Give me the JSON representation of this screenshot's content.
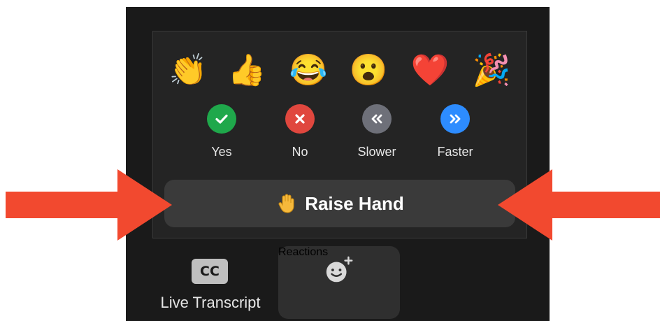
{
  "reactions": {
    "emojis": [
      {
        "name": "clapping-hands",
        "glyph": "👏"
      },
      {
        "name": "thumbs-up",
        "glyph": "👍"
      },
      {
        "name": "tears-of-joy",
        "glyph": "😂"
      },
      {
        "name": "open-mouth",
        "glyph": "😮"
      },
      {
        "name": "red-heart",
        "glyph": "❤️"
      },
      {
        "name": "party-popper",
        "glyph": "🎉"
      }
    ],
    "feedback": [
      {
        "label": "Yes",
        "color": "#1fa84b",
        "icon": "check-icon"
      },
      {
        "label": "No",
        "color": "#e0473e",
        "icon": "close-icon"
      },
      {
        "label": "Slower",
        "color": "#6e7079",
        "icon": "double-chevron-left-icon"
      },
      {
        "label": "Faster",
        "color": "#2d8cff",
        "icon": "double-chevron-right-icon"
      }
    ],
    "raise_hand_label": "Raise Hand"
  },
  "toolbar": {
    "live_transcript_label": "Live Transcript",
    "cc_text": "CC",
    "reactions_label": "Reactions"
  },
  "annotation": {
    "arrow_color": "#f2492f",
    "arrow_count": 2
  }
}
